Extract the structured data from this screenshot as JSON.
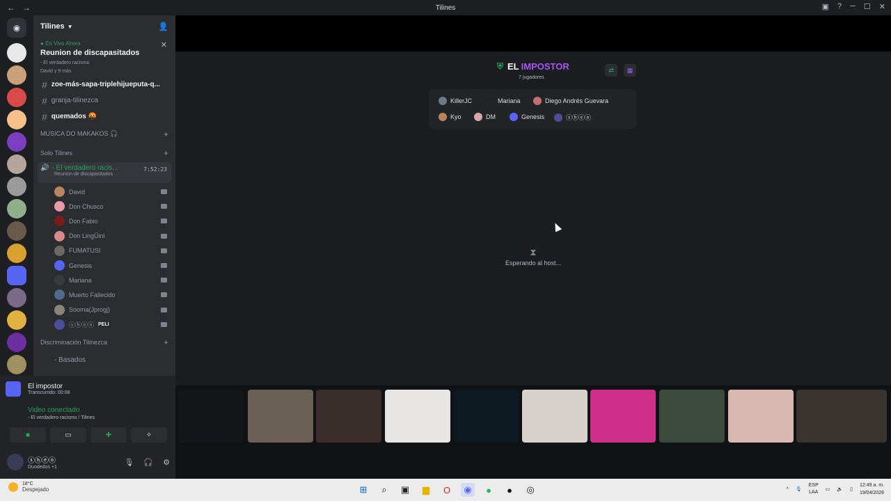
{
  "window": {
    "title": "Tilines",
    "back": "←",
    "forward": "→"
  },
  "guild": {
    "name": "Tilines"
  },
  "live": {
    "tag": "En Vivo Ahora",
    "name": "Reunion de discapasitados",
    "channel": "- El verdadero racismo",
    "people": "David y 9 más"
  },
  "text_channels": [
    {
      "label": "zoe-más-sapa-triplehijueputa-q...",
      "muted": false
    },
    {
      "label": "granja-tilinezca",
      "muted": true
    },
    {
      "label": "quemados 🤬",
      "muted": false
    }
  ],
  "categories": {
    "musica": "MUSICA DO MAKAKOS 🎧",
    "solo": "Solo Tilines",
    "discrim": "Discriminación Tilinezca",
    "basados": "- Basados"
  },
  "voice_channel": {
    "name": "- El verdadero racis...",
    "time": "7:52:23",
    "sub": "Reunion de discapasitados"
  },
  "members": [
    {
      "name": "David",
      "color": "#b9855e"
    },
    {
      "name": "Don Chusco",
      "color": "#e89aa8"
    },
    {
      "name": "Don Fabio",
      "color": "#7a1b1b"
    },
    {
      "name": "Don LingÜini",
      "color": "#d88a8a"
    },
    {
      "name": "FUMATUSI",
      "color": "#6d6a62"
    },
    {
      "name": "Genesis",
      "color": "#5865f2"
    },
    {
      "name": "Mariana",
      "color": "#3a3a3a"
    },
    {
      "name": "Muerto Fallecido",
      "color": "#4f6a8a"
    },
    {
      "name": "Sooma(Jprogj)",
      "color": "#8a8578"
    },
    {
      "name": "ⓢⓗⓔⓞ",
      "color": "#4b4f9a",
      "badge": "PELI"
    }
  ],
  "activity": {
    "title": "El impostor",
    "sub": "Transcurrido: 00:08"
  },
  "voice_status": {
    "title": "Video conectado",
    "sub": "- El verdadero racismo / Tilines"
  },
  "user": {
    "name": "ⓢⓗⓔⓞ",
    "status": "Duodedos +1"
  },
  "game": {
    "title_a": "EL",
    "title_b": "IMPOSTOR",
    "players": "7 jugadores",
    "roster": [
      "KillerJC",
      "Mariana",
      "Diego Andrés Guevara",
      "Kyo",
      "DM",
      "Genesis",
      "ⓢⓗⓔⓞ"
    ],
    "waiting": "Esperando al host..."
  },
  "colors": {
    "accent": "#a855f7",
    "online": "#23a55a",
    "blurple": "#5865f2"
  },
  "taskbar": {
    "temp": "18°C",
    "weather": "Despejado",
    "lang": "ESP",
    "lang2": "LAA",
    "time": "12:49 a. m.",
    "date": "19/04/2026"
  }
}
